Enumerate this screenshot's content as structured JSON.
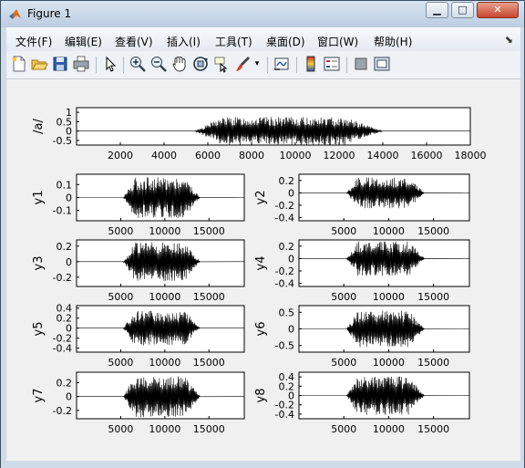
{
  "window": {
    "title": "Figure 1",
    "minimize_label": "▁",
    "maximize_label": "□",
    "close_label": "✕"
  },
  "menu": {
    "items": [
      "文件(F)",
      "编辑(E)",
      "查看(V)",
      "插入(I)",
      "工具(T)",
      "桌面(D)",
      "窗口(W)",
      "帮助(H)"
    ],
    "dock_icon": "dock-arrow-icon"
  },
  "toolbar": {
    "icons": [
      "new-figure-icon",
      "open-file-icon",
      "save-icon",
      "print-icon",
      "edit-plot-arrow-icon",
      "zoom-in-icon",
      "zoom-out-icon",
      "pan-hand-icon",
      "rotate-3d-icon",
      "data-cursor-icon",
      "brush-icon",
      "brush-dropdown-icon",
      "link-plot-icon",
      "colorbar-icon",
      "legend-icon",
      "hide-plot-tools-icon",
      "show-plot-tools-icon"
    ]
  },
  "chart_data": [
    {
      "type": "line",
      "ylabel": "/a/",
      "yticks": [
        "1",
        "0.5",
        "0",
        "-0.5"
      ],
      "xticks": [
        "2000",
        "4000",
        "6000",
        "8000",
        "10000",
        "12000",
        "14000",
        "16000",
        "18000"
      ],
      "xlim": [
        0,
        18000
      ],
      "ylim": [
        -0.75,
        1.25
      ],
      "signal": {
        "start": 5400,
        "end": 14000,
        "amplitude": 0.75
      }
    },
    {
      "type": "line",
      "ylabel": "y1",
      "yticks": [
        "0.1",
        "0",
        "-0.1"
      ],
      "xticks": [
        "5000",
        "10000",
        "15000"
      ],
      "xlim": [
        0,
        19000
      ],
      "ylim": [
        -0.18,
        0.18
      ],
      "signal": {
        "start": 5300,
        "end": 14000,
        "amplitude": 0.16
      }
    },
    {
      "type": "line",
      "ylabel": "y2",
      "yticks": [
        "0.2",
        "0",
        "-0.2",
        "-0.4"
      ],
      "xticks": [
        "5000",
        "10000",
        "15000"
      ],
      "xlim": [
        0,
        19000
      ],
      "ylim": [
        -0.45,
        0.3
      ],
      "signal": {
        "start": 5300,
        "end": 14000,
        "amplitude": 0.25
      }
    },
    {
      "type": "line",
      "ylabel": "y3",
      "yticks": [
        "0.2",
        "0",
        "-0.2"
      ],
      "xticks": [
        "5000",
        "10000",
        "15000"
      ],
      "xlim": [
        0,
        19000
      ],
      "ylim": [
        -0.32,
        0.28
      ],
      "signal": {
        "start": 5300,
        "end": 14000,
        "amplitude": 0.25
      }
    },
    {
      "type": "line",
      "ylabel": "y4",
      "yticks": [
        "0.2",
        "0",
        "-0.2",
        "-0.4"
      ],
      "xticks": [
        "5000",
        "10000",
        "15000"
      ],
      "xlim": [
        0,
        19000
      ],
      "ylim": [
        -0.45,
        0.3
      ],
      "signal": {
        "start": 5300,
        "end": 14000,
        "amplitude": 0.28
      }
    },
    {
      "type": "line",
      "ylabel": "y5",
      "yticks": [
        "0.4",
        "0.2",
        "0",
        "-0.2",
        "-0.4"
      ],
      "xticks": [
        "5000",
        "10000",
        "15000"
      ],
      "xlim": [
        0,
        19000
      ],
      "ylim": [
        -0.48,
        0.45
      ],
      "signal": {
        "start": 5300,
        "end": 14000,
        "amplitude": 0.35
      }
    },
    {
      "type": "line",
      "ylabel": "y6",
      "yticks": [
        "0.5",
        "0",
        "-0.5"
      ],
      "xticks": [
        "5000",
        "10000",
        "15000"
      ],
      "xlim": [
        0,
        19000
      ],
      "ylim": [
        -0.7,
        0.7
      ],
      "signal": {
        "start": 5300,
        "end": 14000,
        "amplitude": 0.55
      }
    },
    {
      "type": "line",
      "ylabel": "y7",
      "yticks": [
        "0.2",
        "0",
        "-0.2"
      ],
      "xticks": [
        "5000",
        "10000",
        "15000"
      ],
      "xlim": [
        0,
        19000
      ],
      "ylim": [
        -0.32,
        0.35
      ],
      "signal": {
        "start": 5300,
        "end": 14000,
        "amplitude": 0.3
      }
    },
    {
      "type": "line",
      "ylabel": "y8",
      "yticks": [
        "0.4",
        "0.2",
        "0",
        "-0.2",
        "-0.4"
      ],
      "xticks": [
        "5000",
        "10000",
        "15000"
      ],
      "xlim": [
        0,
        19000
      ],
      "ylim": [
        -0.5,
        0.5
      ],
      "signal": {
        "start": 5300,
        "end": 14000,
        "amplitude": 0.42
      }
    }
  ]
}
